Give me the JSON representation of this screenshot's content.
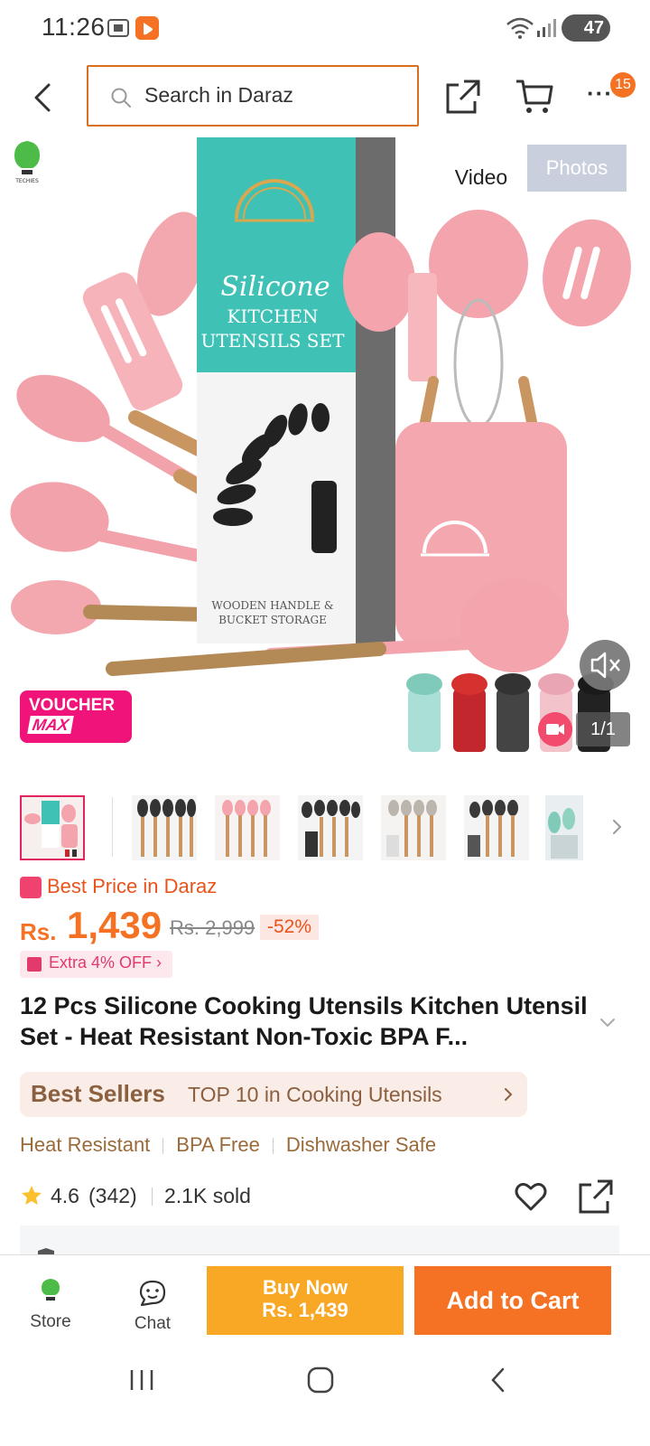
{
  "status_bar": {
    "time": "11:26",
    "battery": "47"
  },
  "header": {
    "search_placeholder": "Search in Daraz",
    "cart_badge": "15",
    "more_label": "···"
  },
  "gallery": {
    "tabs": [
      "Video",
      "Photos"
    ],
    "voucher_line1": "VOUCHER",
    "voucher_line2": "MAX",
    "page_counter": "1/1",
    "box_title": "Silicone",
    "box_subtitle": "KITCHEN UTENSILS SET",
    "box_footer": "WOODEN HANDLE & BUCKET STORAGE",
    "brand_logo_text": "TECHIES"
  },
  "price": {
    "best_price_label": "Best Price in Daraz",
    "currency": "Rs.",
    "current": "1,439",
    "original": "Rs. 2,999",
    "discount": "-52%",
    "extra_off": "Extra 4% OFF"
  },
  "product": {
    "title": "12 Pcs Silicone Cooking Utensils Kitchen Utensil Set - Heat Resistant Non-Toxic BPA F..."
  },
  "best_sellers": {
    "brand": "Best Sellers",
    "rank_text": "TOP 10 in Cooking Utensils"
  },
  "features": [
    "Heat Resistant",
    "BPA Free",
    "Dishwasher Safe"
  ],
  "rating": {
    "value": "4.6",
    "count": "(342)",
    "sold": "2.1K sold"
  },
  "action_bar": {
    "store_label": "Store",
    "chat_label": "Chat",
    "buy_now_label": "Buy Now",
    "buy_now_price": "Rs. 1,439",
    "add_to_cart_label": "Add to Cart"
  },
  "colors": {
    "brand_orange": "#f57224",
    "buy_now_yellow": "#f9a825",
    "voucher_pink": "#f0147a",
    "utensil_pink": "#f4a4ac",
    "box_teal": "#3fc2b5"
  },
  "icons": [
    "back-arrow-icon",
    "search-icon",
    "share-icon",
    "cart-icon",
    "more-icon",
    "mute-icon",
    "video-icon",
    "chevron-right-icon",
    "chevron-down-icon",
    "star-icon",
    "heart-icon",
    "store-icon",
    "chat-icon"
  ]
}
